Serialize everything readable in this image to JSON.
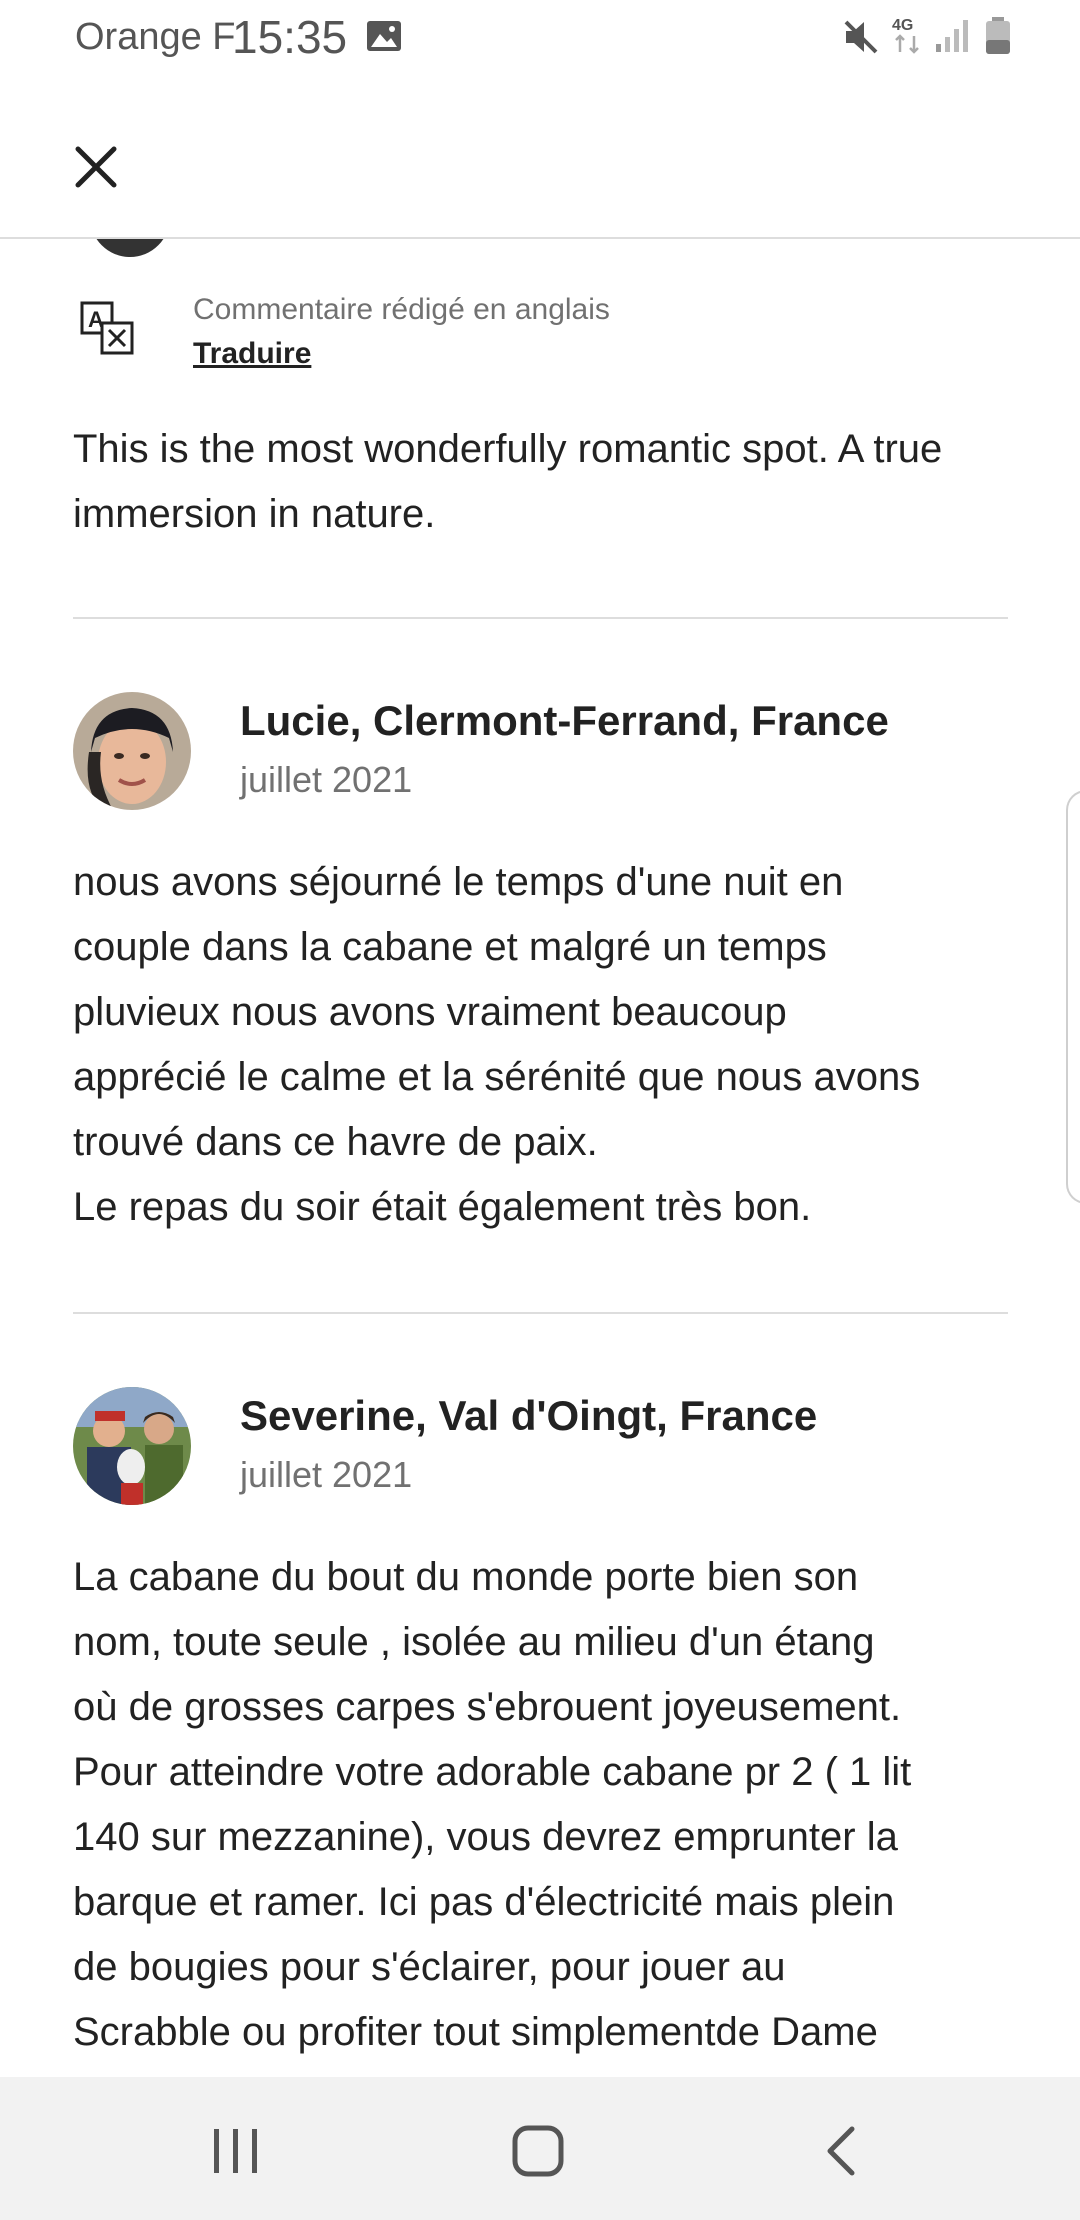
{
  "status_bar": {
    "carrier": "Orange F",
    "time": "15:35",
    "network": "4G",
    "icons": [
      "gallery-icon",
      "mute-icon",
      "network-4g-icon",
      "signal-icon",
      "battery-icon"
    ]
  },
  "header": {
    "close_icon": "close-icon"
  },
  "translation": {
    "note": "Commentaire rédigé en anglais",
    "link": "Traduire",
    "icon": "translate-icon"
  },
  "reviews": [
    {
      "text": "This is the most wonderfully romantic spot. A true immersion in nature."
    },
    {
      "name": "Lucie, Clermont-Ferrand, France",
      "date": "juillet 2021",
      "text": "nous avons séjourné le temps d'une nuit en\ncouple dans la cabane et malgré un temps\npluvieux nous avons vraiment beaucoup\napprécié le calme et la sérénité que nous avons\ntrouvé dans ce havre de paix.\nLe repas du soir était également très bon."
    },
    {
      "name": "Severine, Val d'Oingt, France",
      "date": "juillet 2021",
      "text": "La cabane du bout du monde porte bien son\nnom, toute seule , isolée au milieu d'un étang\noù de grosses carpes s'ebrouent joyeusement.\nPour atteindre votre adorable cabane pr 2 ( 1 lit\n140 sur mezzanine), vous devrez emprunter la\nbarque et ramer. Ici pas d'électricité mais plein\nde bougies pour s'éclairer, pour jouer au\nScrabble ou profiter tout simplementde Dame"
    }
  ],
  "nav_bar": {
    "icons": [
      "recents-icon",
      "home-icon",
      "back-icon"
    ]
  }
}
